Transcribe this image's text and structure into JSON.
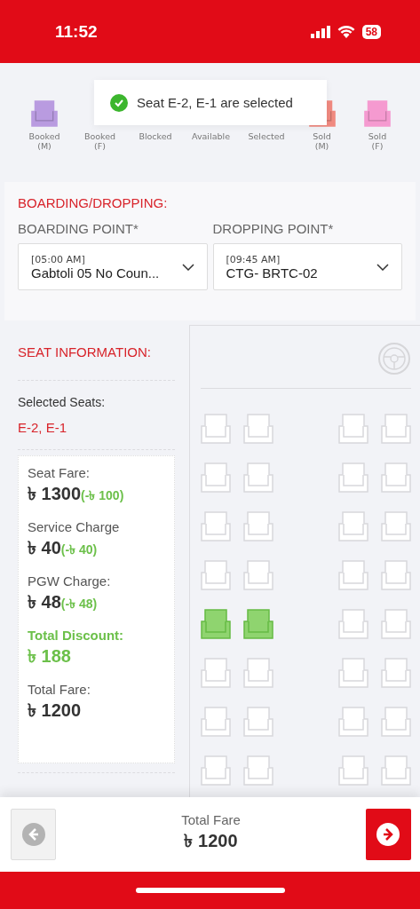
{
  "status_bar": {
    "time": "11:52",
    "battery": "58"
  },
  "legend": [
    {
      "label": "Booked\n(M)",
      "color": "#b99be0"
    },
    {
      "label": "Booked\n(F)"
    },
    {
      "label": "Blocked"
    },
    {
      "label": "Available"
    },
    {
      "label": "Selected"
    },
    {
      "label": "Sold\n(M)",
      "color": "#f08a80"
    },
    {
      "label": "Sold\n(F)",
      "color": "#f59ad0"
    }
  ],
  "toast": {
    "message": "Seat E-2, E-1 are selected"
  },
  "boarding": {
    "title": "BOARDING/DROPPING:",
    "fields": [
      {
        "label": "BOARDING POINT*",
        "time": "[05:00 AM]",
        "value": "Gabtoli 05 No Coun..."
      },
      {
        "label": "DROPPING POINT*",
        "time": "[09:45 AM]",
        "value": "CTG- BRTC-02"
      }
    ]
  },
  "seat_info": {
    "title": "SEAT INFORMATION:",
    "selected_label": "Selected Seats:",
    "selected_value": "E-2, E-1",
    "fares": [
      {
        "kind": "fare",
        "label": "Seat Fare:",
        "amount": "৳ 1300",
        "discount": "(-৳ 100)"
      },
      {
        "kind": "fare",
        "label": "Service Charge",
        "amount": "৳ 40",
        "discount": "(-৳ 40)"
      },
      {
        "kind": "fare",
        "label": "PGW Charge:",
        "amount": "৳ 48",
        "discount": "(-৳ 48)"
      },
      {
        "kind": "discount",
        "label": "Total Discount:",
        "amount": "৳ 188"
      },
      {
        "kind": "fare",
        "label": "Total Fare:",
        "amount": "৳ 1200"
      }
    ]
  },
  "seat_map": {
    "rows": [
      {
        "seats": [
          {
            "selected": false
          },
          {
            "selected": false
          },
          {
            "selected": false
          },
          {
            "selected": false
          }
        ]
      },
      {
        "seats": [
          {
            "selected": false
          },
          {
            "selected": false
          },
          {
            "selected": false
          },
          {
            "selected": false
          }
        ]
      },
      {
        "seats": [
          {
            "selected": false
          },
          {
            "selected": false
          },
          {
            "selected": false
          },
          {
            "selected": false
          }
        ]
      },
      {
        "seats": [
          {
            "selected": false
          },
          {
            "selected": false
          },
          {
            "selected": false
          },
          {
            "selected": false
          }
        ]
      },
      {
        "seats": [
          {
            "selected": true
          },
          {
            "selected": true
          },
          {
            "selected": false
          },
          {
            "selected": false
          }
        ]
      },
      {
        "seats": [
          {
            "selected": false
          },
          {
            "selected": false
          },
          {
            "selected": false
          },
          {
            "selected": false
          }
        ]
      },
      {
        "seats": [
          {
            "selected": false
          },
          {
            "selected": false
          },
          {
            "selected": false
          },
          {
            "selected": false
          }
        ]
      },
      {
        "seats": [
          {
            "selected": false
          },
          {
            "selected": false
          },
          {
            "selected": false
          },
          {
            "selected": false
          }
        ]
      }
    ]
  },
  "footer": {
    "label": "Total Fare",
    "amount": "৳ 1200"
  }
}
